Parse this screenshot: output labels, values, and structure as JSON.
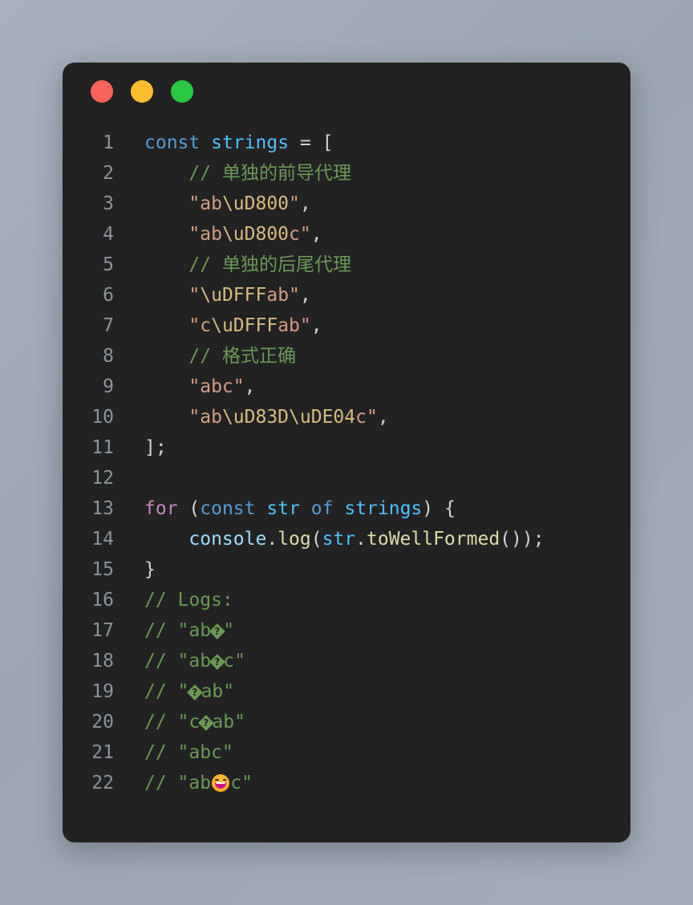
{
  "window": {
    "name": "code-snippet-window",
    "background": "#222222",
    "page_background_from": "#a7b1bc",
    "page_background_to": "#a3adb8",
    "traffic_lights": [
      {
        "name": "close-button",
        "label": "close",
        "color": "#f9635c"
      },
      {
        "name": "minimize-button",
        "label": "minimize",
        "color": "#febc2e"
      },
      {
        "name": "maximize-button",
        "label": "maximize",
        "color": "#28c840"
      }
    ]
  },
  "editor": {
    "language": "javascript",
    "line_numbers": [
      "1",
      "2",
      "3",
      "4",
      "5",
      "6",
      "7",
      "8",
      "9",
      "10",
      "11",
      "12",
      "13",
      "14",
      "15",
      "16",
      "17",
      "18",
      "19",
      "20",
      "21",
      "22"
    ],
    "plain_text": [
      "const strings = [",
      "    // 单独的前导代理",
      "    \"ab\\uD800\",",
      "    \"ab\\uD800c\",",
      "    // 单独的后尾代理",
      "    \"\\uDFFFab\",",
      "    \"c\\uDFFFab\",",
      "    // 格式正确",
      "    \"abc\",",
      "    \"ab\\uD83D\\uDE04c\",",
      "];",
      "",
      "for (const str of strings) {",
      "    console.log(str.toWellFormed());",
      "}",
      "// Logs:",
      "// \"ab�\"",
      "// \"ab�c\"",
      "// \"�ab\"",
      "// \"c�ab\"",
      "// \"abc\"",
      "// \"ab😄c\""
    ],
    "tokens": [
      [
        {
          "t": "kw",
          "v": "const"
        },
        {
          "t": "plain",
          "v": " "
        },
        {
          "t": "varb",
          "v": "strings"
        },
        {
          "t": "plain",
          "v": " "
        },
        {
          "t": "punct",
          "v": "="
        },
        {
          "t": "plain",
          "v": " "
        },
        {
          "t": "punct",
          "v": "["
        }
      ],
      [
        {
          "t": "plain",
          "v": "    "
        },
        {
          "t": "cmt",
          "v": "// "
        },
        {
          "t": "cmt-cjk",
          "v": "单独的前导代理"
        }
      ],
      [
        {
          "t": "plain",
          "v": "    "
        },
        {
          "t": "str",
          "v": "\"ab"
        },
        {
          "t": "esc",
          "v": "\\uD800"
        },
        {
          "t": "str",
          "v": "\""
        },
        {
          "t": "punct",
          "v": ","
        }
      ],
      [
        {
          "t": "plain",
          "v": "    "
        },
        {
          "t": "str",
          "v": "\"ab"
        },
        {
          "t": "esc",
          "v": "\\uD800"
        },
        {
          "t": "str",
          "v": "c\""
        },
        {
          "t": "punct",
          "v": ","
        }
      ],
      [
        {
          "t": "plain",
          "v": "    "
        },
        {
          "t": "cmt",
          "v": "// "
        },
        {
          "t": "cmt-cjk",
          "v": "单独的后尾代理"
        }
      ],
      [
        {
          "t": "plain",
          "v": "    "
        },
        {
          "t": "str",
          "v": "\""
        },
        {
          "t": "esc",
          "v": "\\uDFFF"
        },
        {
          "t": "str",
          "v": "ab\""
        },
        {
          "t": "punct",
          "v": ","
        }
      ],
      [
        {
          "t": "plain",
          "v": "    "
        },
        {
          "t": "str",
          "v": "\"c"
        },
        {
          "t": "esc",
          "v": "\\uDFFF"
        },
        {
          "t": "str",
          "v": "ab\""
        },
        {
          "t": "punct",
          "v": ","
        }
      ],
      [
        {
          "t": "plain",
          "v": "    "
        },
        {
          "t": "cmt",
          "v": "// "
        },
        {
          "t": "cmt-cjk",
          "v": "格式正确"
        }
      ],
      [
        {
          "t": "plain",
          "v": "    "
        },
        {
          "t": "str",
          "v": "\"abc\""
        },
        {
          "t": "punct",
          "v": ","
        }
      ],
      [
        {
          "t": "plain",
          "v": "    "
        },
        {
          "t": "str",
          "v": "\"ab"
        },
        {
          "t": "esc",
          "v": "\\uD83D"
        },
        {
          "t": "esc",
          "v": "\\uDE04"
        },
        {
          "t": "str",
          "v": "c\""
        },
        {
          "t": "punct",
          "v": ","
        }
      ],
      [
        {
          "t": "punct",
          "v": "];"
        }
      ],
      [
        {
          "t": "plain",
          "v": ""
        }
      ],
      [
        {
          "t": "kwctrl",
          "v": "for"
        },
        {
          "t": "plain",
          "v": " "
        },
        {
          "t": "punct",
          "v": "("
        },
        {
          "t": "kw",
          "v": "const"
        },
        {
          "t": "plain",
          "v": " "
        },
        {
          "t": "varb",
          "v": "str"
        },
        {
          "t": "plain",
          "v": " "
        },
        {
          "t": "kw",
          "v": "of"
        },
        {
          "t": "plain",
          "v": " "
        },
        {
          "t": "varb",
          "v": "strings"
        },
        {
          "t": "punct",
          "v": ") {"
        }
      ],
      [
        {
          "t": "plain",
          "v": "    "
        },
        {
          "t": "var",
          "v": "console"
        },
        {
          "t": "punct",
          "v": "."
        },
        {
          "t": "fn",
          "v": "log"
        },
        {
          "t": "punct",
          "v": "("
        },
        {
          "t": "varb",
          "v": "str"
        },
        {
          "t": "punct",
          "v": "."
        },
        {
          "t": "fn",
          "v": "toWellFormed"
        },
        {
          "t": "punct",
          "v": "());"
        }
      ],
      [
        {
          "t": "punct",
          "v": "}"
        }
      ],
      [
        {
          "t": "cmt",
          "v": "// Logs:"
        }
      ],
      [
        {
          "t": "cmt",
          "v": "// \"ab"
        },
        {
          "t": "repl",
          "v": "�"
        },
        {
          "t": "cmt",
          "v": "\""
        }
      ],
      [
        {
          "t": "cmt",
          "v": "// \"ab"
        },
        {
          "t": "repl",
          "v": "�"
        },
        {
          "t": "cmt",
          "v": "c\""
        }
      ],
      [
        {
          "t": "cmt",
          "v": "// \""
        },
        {
          "t": "repl",
          "v": "�"
        },
        {
          "t": "cmt",
          "v": "ab\""
        }
      ],
      [
        {
          "t": "cmt",
          "v": "// \"c"
        },
        {
          "t": "repl",
          "v": "�"
        },
        {
          "t": "cmt",
          "v": "ab\""
        }
      ],
      [
        {
          "t": "cmt",
          "v": "// \"abc\""
        }
      ],
      [
        {
          "t": "cmt",
          "v": "// \"ab"
        },
        {
          "t": "emoji",
          "v": "😄"
        },
        {
          "t": "cmt",
          "v": "c\""
        }
      ]
    ],
    "colors": {
      "keyword": "#569cd6",
      "keyword_control": "#c586c0",
      "variable": "#9cdcfe",
      "variable_bright": "#4fc1ff",
      "function": "#dcdcaa",
      "string": "#d69d85",
      "escape": "#d7ba7d",
      "comment": "#6a9955",
      "plain": "#d4d4d4",
      "line_number": "#8b939c"
    }
  }
}
